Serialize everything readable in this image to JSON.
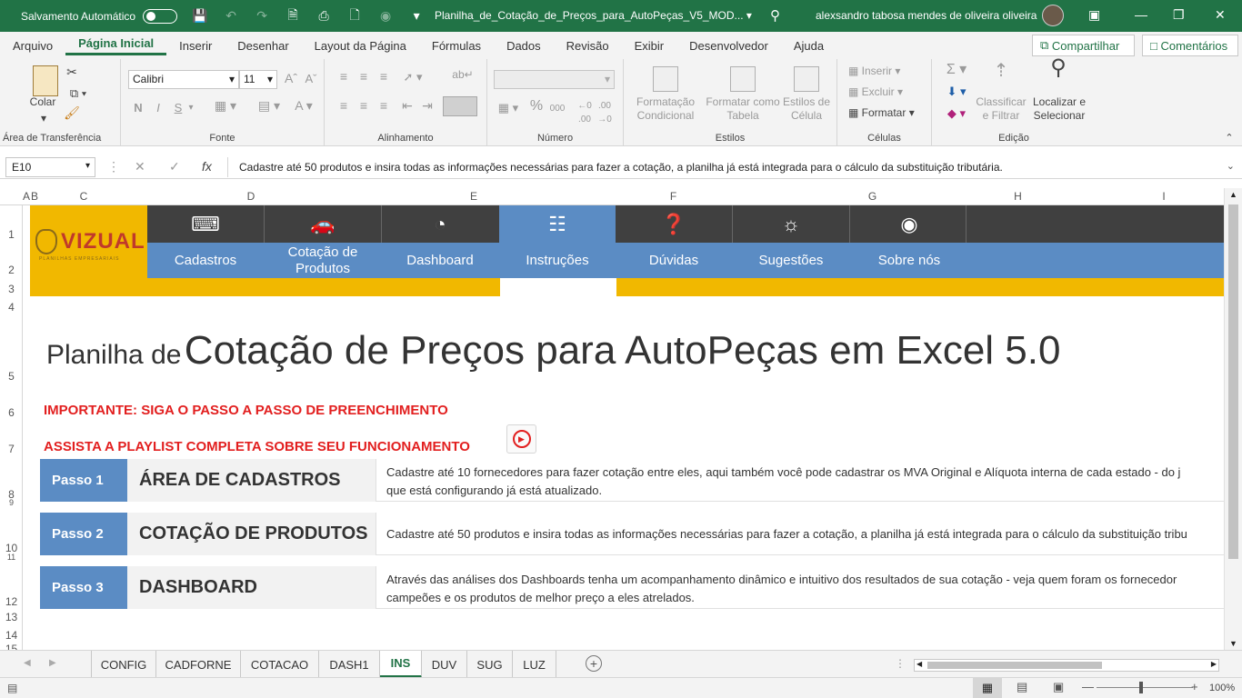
{
  "titlebar": {
    "autosave_label": "Salvamento Automático",
    "document_title": "Planilha_de_Cotação_de_Preços_para_AutoPeças_V5_MOD...",
    "user_name": "alexsandro tabosa mendes de oliveira oliveira"
  },
  "menu": {
    "items": [
      "Arquivo",
      "Página Inicial",
      "Inserir",
      "Desenhar",
      "Layout da Página",
      "Fórmulas",
      "Dados",
      "Revisão",
      "Exibir",
      "Desenvolvedor",
      "Ajuda"
    ],
    "active": "Página Inicial",
    "share_label": "Compartilhar",
    "comments_label": "Comentários"
  },
  "ribbon": {
    "clipboard": {
      "paste_label": "Colar",
      "group_label": "Área de Transferência"
    },
    "font": {
      "font_name": "Calibri",
      "font_size": "11",
      "bold": "N",
      "italic": "I",
      "underline": "S",
      "group_label": "Fonte"
    },
    "alignment": {
      "group_label": "Alinhamento"
    },
    "number": {
      "percent": "%",
      "thousands": "000",
      "group_label": "Número"
    },
    "styles": {
      "conditional": "Formatação Condicional",
      "table": "Formatar como Tabela",
      "cell_styles": "Estilos de Célula",
      "group_label": "Estilos"
    },
    "cells": {
      "insert": "Inserir",
      "delete": "Excluir",
      "format": "Formatar",
      "group_label": "Células"
    },
    "editing": {
      "sort": "Classificar e Filtrar",
      "find": "Localizar e Selecionar",
      "group_label": "Edição"
    }
  },
  "formula_bar": {
    "name_box": "E10",
    "fx": "fx",
    "content": "Cadastre até 50 produtos e insira todas as informações necessárias para fazer a cotação, a planilha já está integrada para o cálculo da substituição tributária."
  },
  "columns": [
    "A",
    "B",
    "C",
    "D",
    "E",
    "F",
    "G",
    "H",
    "I"
  ],
  "rows": [
    "1",
    "2",
    "3",
    "4",
    "5",
    "6",
    "7",
    "8",
    "9",
    "10",
    "11",
    "12",
    "13",
    "14",
    "15"
  ],
  "banner": {
    "logo_name": "VIZUAL",
    "logo_sub": "PLANILHAS EMPRESARIAIS",
    "tabs": [
      {
        "label": "Cadastros",
        "icon": "typewriter-icon"
      },
      {
        "label": "Cotação de Produtos",
        "icon": "car-icon"
      },
      {
        "label": "Dashboard",
        "icon": "pie-chart-icon"
      },
      {
        "label": "Instruções",
        "icon": "teacher-board-icon"
      },
      {
        "label": "Dúvidas",
        "icon": "question-person-icon"
      },
      {
        "label": "Sugestões",
        "icon": "lightbulb-icon"
      },
      {
        "label": "Sobre nós",
        "icon": "owl-pin-icon"
      }
    ],
    "selected": "Instruções"
  },
  "content": {
    "title_prefix": "Planilha de",
    "title_main": "Cotação de Preços para AutoPeças em Excel 5.0",
    "important": "IMPORTANTE: SIGA O PASSO A PASSO DE PREENCHIMENTO",
    "playlist": "ASSISTA A PLAYLIST COMPLETA SOBRE SEU FUNCIONAMENTO",
    "steps": [
      {
        "badge": "Passo 1",
        "title": "ÁREA DE CADASTROS",
        "desc_line1": "Cadastre até 10 fornecedores para fazer cotação entre eles, aqui também você pode cadastrar os MVA Original e Alíquota interna de cada estado - do j",
        "desc_line2": "que está configurando já está atualizado."
      },
      {
        "badge": "Passo 2",
        "title": "COTAÇÃO DE PRODUTOS",
        "desc_line1": "Cadastre até 50 produtos e insira todas as informações necessárias para fazer a cotação, a planilha já está integrada para o cálculo da substituição tribu",
        "desc_line2": ""
      },
      {
        "badge": "Passo 3",
        "title": "DASHBOARD",
        "desc_line1": "Através das análises dos Dashboards tenha um acompanhamento dinâmico e intuitivo dos resultados de sua cotação - veja quem foram os fornecedor",
        "desc_line2": "campeões e os produtos de melhor preço a eles atrelados."
      }
    ]
  },
  "sheet_tabs": [
    "CONFIG",
    "CADFORNE",
    "COTACAO",
    "DASH1",
    "INS",
    "DUV",
    "SUG",
    "LUZ"
  ],
  "active_sheet": "INS",
  "status": {
    "zoom": "100%"
  },
  "colors": {
    "excel_green": "#217346",
    "nav_blue": "#5b8cc4",
    "banner_gold": "#f1b800",
    "nav_dark": "#404040",
    "alert_red": "#e21f1f"
  }
}
